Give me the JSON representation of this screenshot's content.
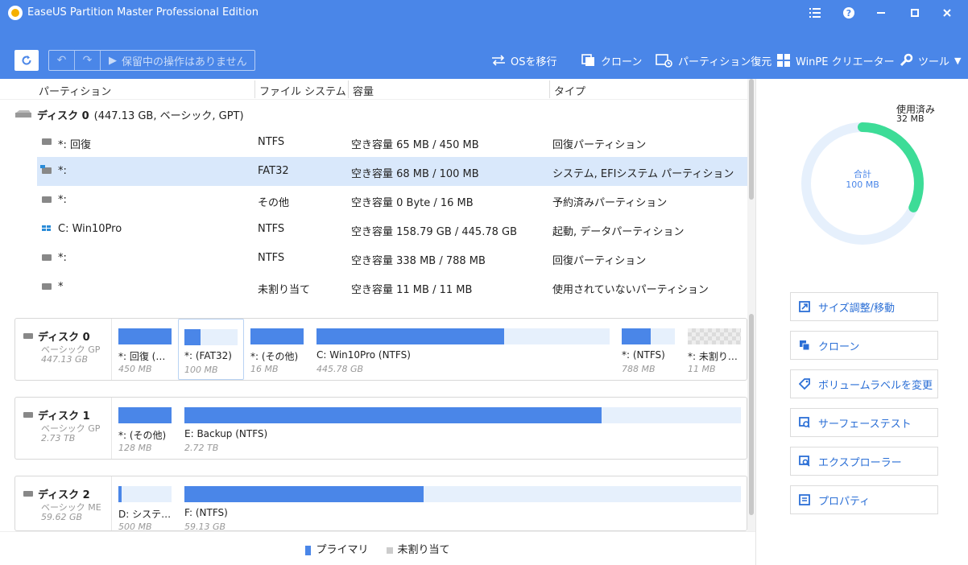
{
  "window": {
    "title": "EaseUS Partition Master Professional Edition"
  },
  "toolbar": {
    "pending": "保留中の操作はありません",
    "actions": [
      {
        "label": "OSを移行"
      },
      {
        "label": "クローン"
      },
      {
        "label": "パーティション復元"
      },
      {
        "label": "WinPE クリエーター"
      },
      {
        "label": "ツール"
      }
    ]
  },
  "table": {
    "headers": [
      "パーティション",
      "ファイル システム",
      "容量",
      "タイプ"
    ],
    "disk0": {
      "name": "ディスク 0",
      "detail": "(447.13 GB, ベーシック, GPT)"
    },
    "rows": [
      {
        "name": "*: 回復",
        "fs": "NTFS",
        "capacity": "空き容量 65 MB / 450 MB",
        "type": "回復パーティション"
      },
      {
        "name": "*:",
        "fs": "FAT32",
        "capacity": "空き容量 68 MB / 100 MB",
        "type": "システム, EFIシステム パーティション"
      },
      {
        "name": "*:",
        "fs": "その他",
        "capacity": "空き容量 0 Byte / 16 MB",
        "type": "予約済みパーティション"
      },
      {
        "name": "C: Win10Pro",
        "fs": "NTFS",
        "capacity": "空き容量 158.79 GB / 445.78 GB",
        "type": "起動, データパーティション"
      },
      {
        "name": "*:",
        "fs": "NTFS",
        "capacity": "空き容量 338 MB / 788 MB",
        "type": "回復パーティション"
      },
      {
        "name": "*",
        "fs": "未割り当て",
        "capacity": "空き容量 11 MB / 11 MB",
        "type": "使用されていないパーティション"
      }
    ]
  },
  "disks": [
    {
      "name": "ディスク 0",
      "type": "ベーシック GP",
      "size": "447.13 GB",
      "partitions": [
        {
          "label": "*: 回復 (…",
          "size": "450 MB",
          "used_pct": 100
        },
        {
          "label": "*: (FAT32)",
          "size": "100 MB",
          "used_pct": 30
        },
        {
          "label": "*: (その他)",
          "size": "16 MB",
          "used_pct": 100
        },
        {
          "label": "C: Win10Pro (NTFS)",
          "size": "445.78 GB",
          "used_pct": 64
        },
        {
          "label": "*: (NTFS)",
          "size": "788 MB",
          "used_pct": 55
        },
        {
          "label": "*: 未割り…",
          "size": "11 MB",
          "used_pct": 0
        }
      ]
    },
    {
      "name": "ディスク 1",
      "type": "ベーシック GP",
      "size": "2.73 TB",
      "partitions": [
        {
          "label": "*: (その他)",
          "size": "128 MB",
          "used_pct": 100
        },
        {
          "label": "E: Backup (NTFS)",
          "size": "2.72 TB",
          "used_pct": 75
        }
      ]
    },
    {
      "name": "ディスク 2",
      "type": "ベーシック ME",
      "size": "59.62 GB",
      "partitions": [
        {
          "label": "D: システ…",
          "size": "500 MB",
          "used_pct": 6
        },
        {
          "label": "F: (NTFS)",
          "size": "59.13 GB",
          "used_pct": 43
        }
      ]
    }
  ],
  "legend": {
    "primary": "プライマリ",
    "unallocated": "未割り当て"
  },
  "usage": {
    "used_label": "使用済み",
    "used_value": "32 MB",
    "total_label": "合計",
    "total_value": "100 MB",
    "used_pct": 32,
    "colors": {
      "used": "#3ddc97",
      "track": "#e6f0fc"
    }
  },
  "side_actions": [
    {
      "label": "サイズ調整/移動"
    },
    {
      "label": "クローン"
    },
    {
      "label": "ボリュームラベルを変更"
    },
    {
      "label": "サーフェーステスト"
    },
    {
      "label": "エクスプローラー"
    },
    {
      "label": "プロパティ"
    }
  ]
}
